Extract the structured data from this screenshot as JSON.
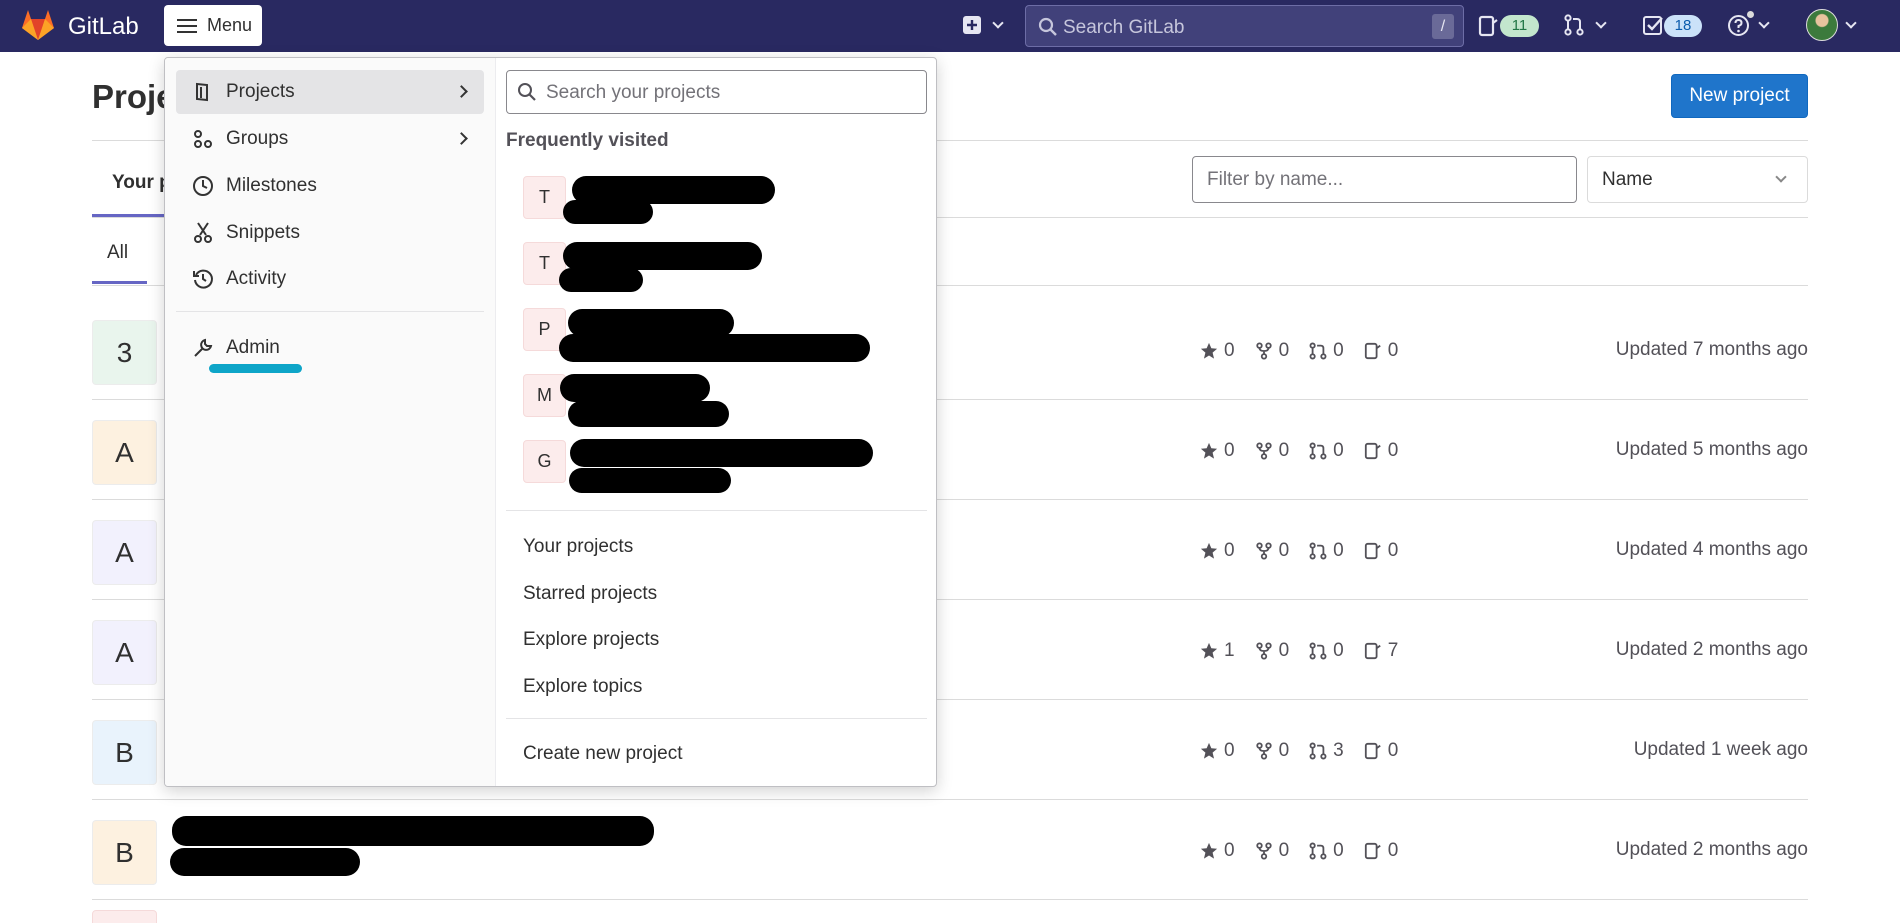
{
  "navbar": {
    "brand": "GitLab",
    "menu_label": "Menu",
    "search_placeholder": "Search GitLab",
    "search_shortcut": "/",
    "issues_count": "11",
    "todos_count": "18",
    "colors": {
      "bg": "#292961",
      "logo": "#fc6d26"
    }
  },
  "page": {
    "title": "Projects",
    "new_project_label": "New project",
    "tab_yours": "Your projects",
    "tab_all": "All",
    "filter_placeholder": "Filter by name...",
    "sort_label": "Name"
  },
  "projects": [
    {
      "avatar": "3",
      "avatar_bg": "#e9f5ed",
      "stars": "0",
      "forks": "0",
      "mrs": "0",
      "issues": "0",
      "updated": "Updated 7 months ago"
    },
    {
      "avatar": "A",
      "avatar_bg": "#fdf1e0",
      "stars": "0",
      "forks": "0",
      "mrs": "0",
      "issues": "0",
      "updated": "Updated 5 months ago"
    },
    {
      "avatar": "A",
      "avatar_bg": "#f2f1fd",
      "stars": "0",
      "forks": "0",
      "mrs": "0",
      "issues": "0",
      "updated": "Updated 4 months ago"
    },
    {
      "avatar": "A",
      "avatar_bg": "#f2f1fd",
      "stars": "1",
      "forks": "0",
      "mrs": "0",
      "issues": "7",
      "updated": "Updated 2 months ago"
    },
    {
      "avatar": "B",
      "avatar_bg": "#e9f3fc",
      "stars": "0",
      "forks": "0",
      "mrs": "3",
      "issues": "0",
      "updated": "Updated 1 week ago"
    },
    {
      "avatar": "B",
      "avatar_bg": "#fdf1e0",
      "stars": "0",
      "forks": "0",
      "mrs": "0",
      "issues": "0",
      "updated": "Updated 2 months ago"
    }
  ],
  "dropdown": {
    "nav": [
      {
        "label": "Projects",
        "icon": "project-icon"
      },
      {
        "label": "Groups",
        "icon": "group-icon"
      },
      {
        "label": "Milestones",
        "icon": "clock-icon"
      },
      {
        "label": "Snippets",
        "icon": "snippet-icon"
      },
      {
        "label": "Activity",
        "icon": "history-icon"
      },
      {
        "label": "Admin",
        "icon": "admin-wrench-icon"
      }
    ],
    "search_placeholder": "Search your projects",
    "frequently_visited_title": "Frequently visited",
    "frequent": [
      "T",
      "T",
      "P",
      "M",
      "G"
    ],
    "links": [
      "Your projects",
      "Starred projects",
      "Explore projects",
      "Explore topics"
    ],
    "create_label": "Create new project"
  }
}
